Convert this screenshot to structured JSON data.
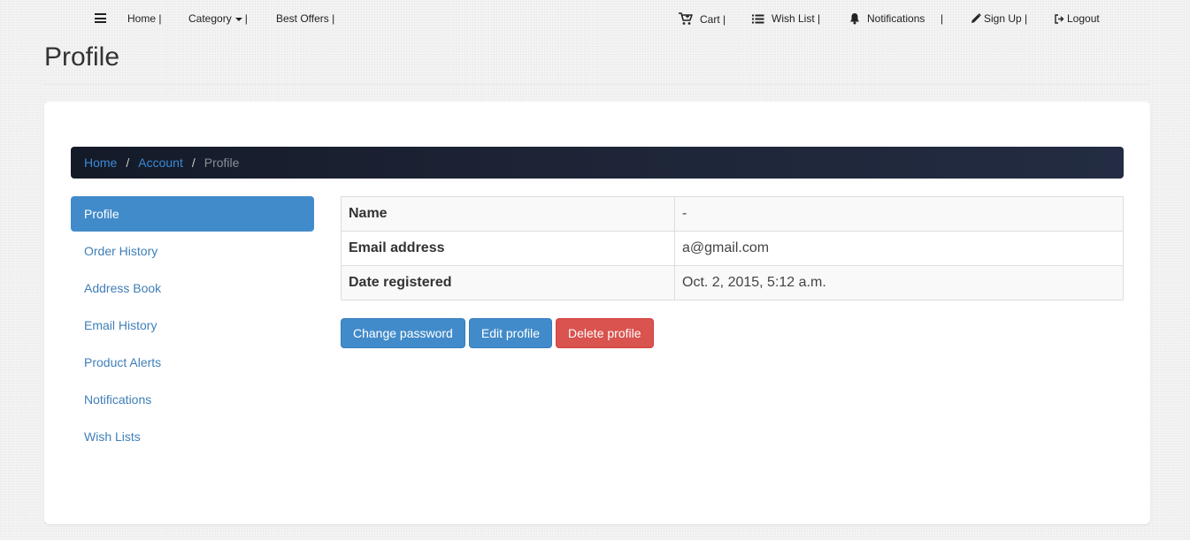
{
  "nav": {
    "left": [
      {
        "label": "Home |"
      },
      {
        "label": "Category"
      },
      {
        "label": "Best Offers |"
      }
    ],
    "category_sep": "|",
    "right": [
      {
        "label": "Cart |",
        "icon": "cart-icon"
      },
      {
        "label": "Wish List |",
        "icon": "list-icon"
      },
      {
        "label": "Notifications",
        "icon": "bell-icon"
      },
      {
        "label": "Sign Up |",
        "icon": "pencil-icon"
      },
      {
        "label": "Logout",
        "icon": "logout-icon"
      }
    ],
    "notifications_sep": "|"
  },
  "page": {
    "title": "Profile"
  },
  "breadcrumb": {
    "items": [
      "Home",
      "Account"
    ],
    "active": "Profile",
    "divider": "/"
  },
  "sidebar": {
    "items": [
      {
        "label": "Profile",
        "active": true
      },
      {
        "label": "Order History"
      },
      {
        "label": "Address Book"
      },
      {
        "label": "Email History"
      },
      {
        "label": "Product Alerts"
      },
      {
        "label": "Notifications"
      },
      {
        "label": "Wish Lists"
      }
    ]
  },
  "profile": {
    "rows": [
      {
        "label": "Name",
        "value": "-"
      },
      {
        "label": "Email address",
        "value": "a@gmail.com"
      },
      {
        "label": "Date registered",
        "value": "Oct. 2, 2015, 5:12 a.m."
      }
    ]
  },
  "actions": {
    "change_password": "Change password",
    "edit_profile": "Edit profile",
    "delete_profile": "Delete profile"
  },
  "colors": {
    "primary": "#428bca",
    "danger": "#d9534f",
    "breadcrumb_bg": "#1d2436",
    "link": "#3a8ad6"
  }
}
